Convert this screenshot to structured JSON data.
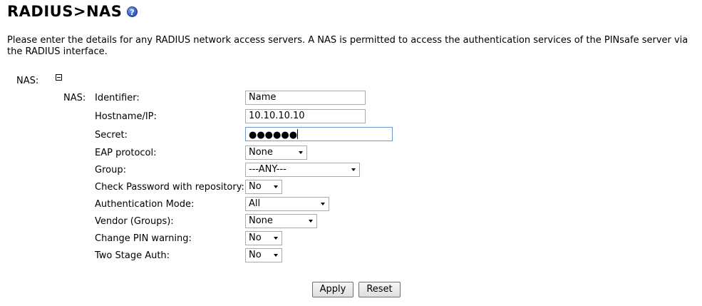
{
  "header": {
    "title": "RADIUS>NAS",
    "help_icon": "help-icon",
    "help_glyph": "?"
  },
  "intro": "Please enter the details for any RADIUS network access servers. A NAS is permitted to access the authentication services of the PINsafe server via the RADIUS interface.",
  "nas_section": {
    "label": "NAS:",
    "inner_label": "NAS:",
    "collapse_icon": "collapse-icon"
  },
  "fields": {
    "identifier": {
      "label": "Identifier:",
      "value": "Name"
    },
    "hostname": {
      "label": "Hostname/IP:",
      "value": "10.10.10.10"
    },
    "secret": {
      "label": "Secret:",
      "value": "●●●●●●"
    },
    "eap_protocol": {
      "label": "EAP protocol:",
      "value": "None"
    },
    "group": {
      "label": "Group:",
      "value": "---ANY---"
    },
    "check_password": {
      "label": "Check Password with repository:",
      "value": "No"
    },
    "auth_mode": {
      "label": "Authentication Mode:",
      "value": "All"
    },
    "vendor": {
      "label": "Vendor (Groups):",
      "value": "None"
    },
    "change_pin": {
      "label": "Change PIN warning:",
      "value": "No"
    },
    "two_stage": {
      "label": "Two Stage Auth:",
      "value": "No"
    }
  },
  "buttons": {
    "apply": "Apply",
    "reset": "Reset"
  }
}
